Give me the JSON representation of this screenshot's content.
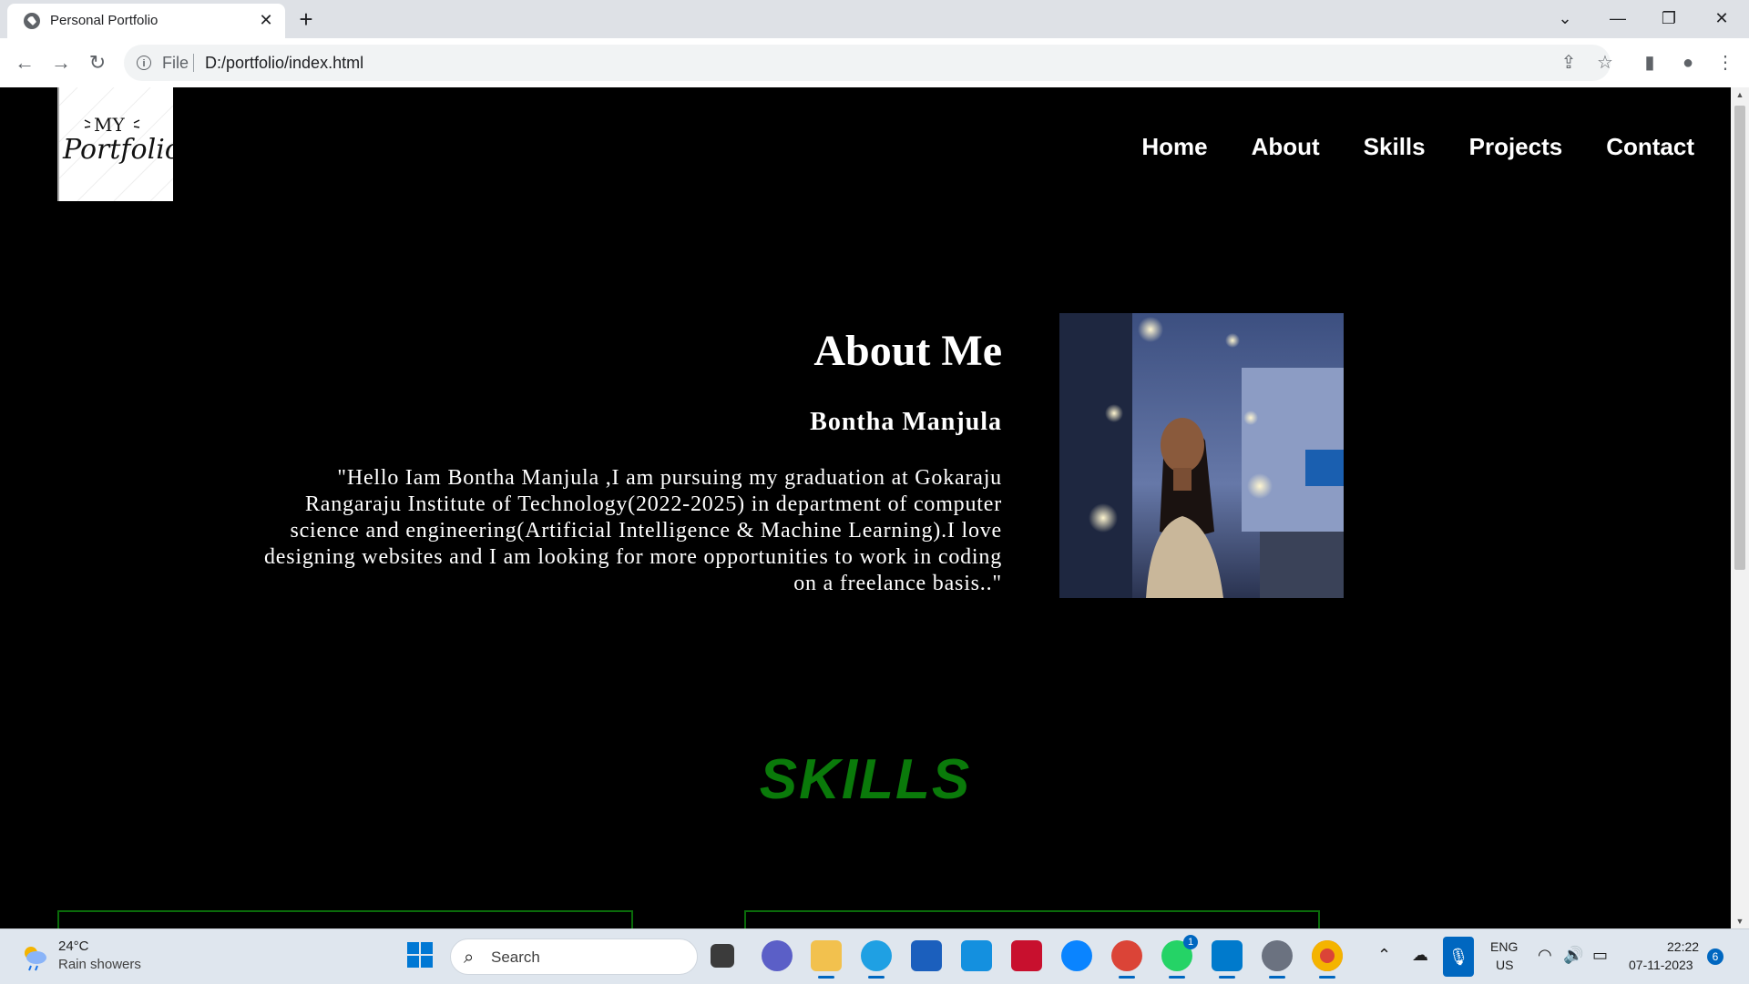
{
  "browser": {
    "tab_title": "Personal Portfolio",
    "url_scheme": "File",
    "url": "D:/portfolio/index.html"
  },
  "site": {
    "nav": [
      "Home",
      "About",
      "Skills",
      "Projects",
      "Contact"
    ],
    "about": {
      "title": "About Me",
      "name": "Bontha Manjula",
      "text": "\"Hello Iam Bontha Manjula ,I am pursuing my graduation at Gokaraju Rangaraju Institute of Technology(2022-2025) in department of computer science and engineering(Artificial Intelligence & Machine Learning).I love designing websites and I am looking for more opportunities to work in coding on a freelance basis..\""
    },
    "skills_title": "SKILLS"
  },
  "taskbar": {
    "weather_temp": "24°C",
    "weather_desc": "Rain showers",
    "search_label": "Search",
    "lang1": "ENG",
    "lang2": "US",
    "time": "22:22",
    "date": "07-11-2023",
    "notification_count": "6",
    "whatsapp_badge": "1"
  },
  "colors": {
    "skills_green": "#0a7a0a",
    "page_bg": "#000000",
    "accent_blue": "#0067c0"
  }
}
